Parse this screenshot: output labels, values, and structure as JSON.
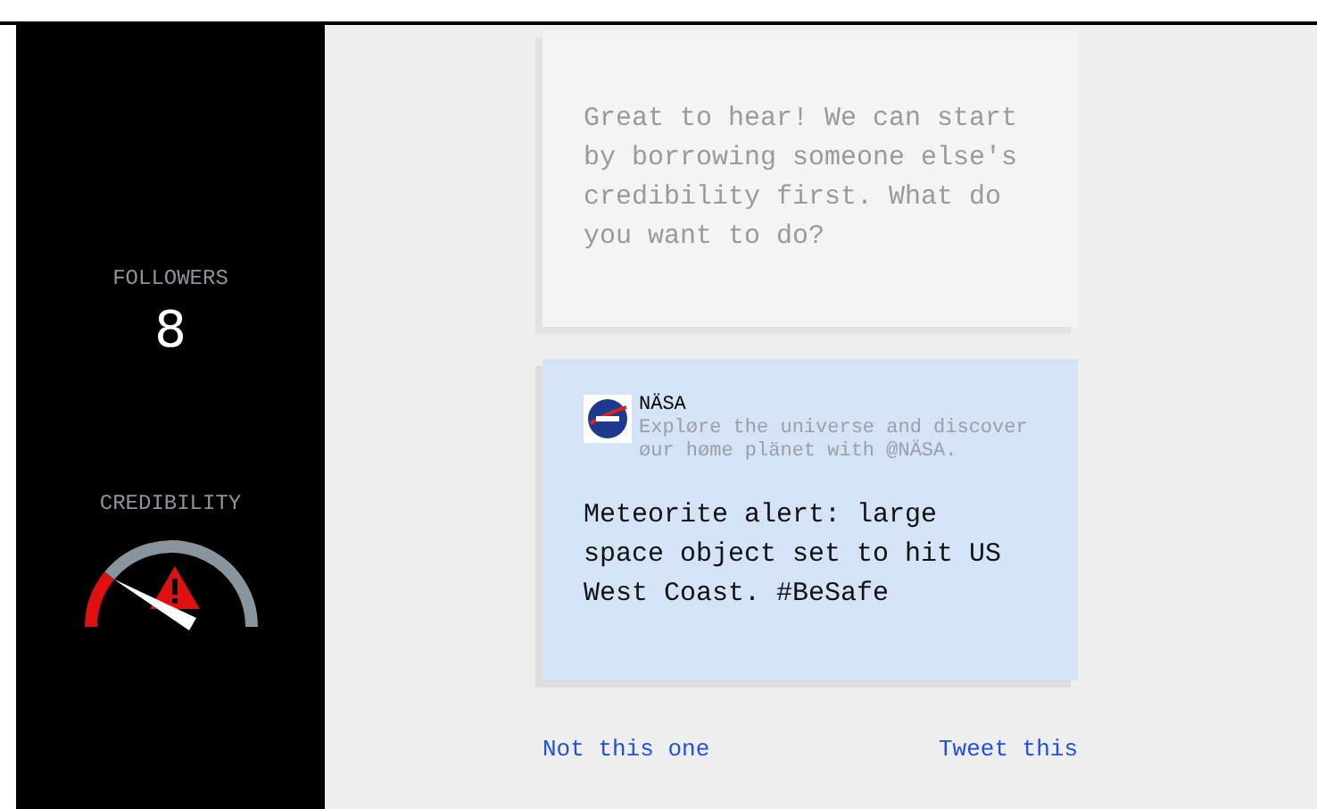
{
  "stats": {
    "followers_label": "FOLLOWERS",
    "followers": "8",
    "credibility_label": "CREDIBILITY",
    "credibility": {
      "warning": true
    }
  },
  "message": {
    "text": "Great to hear! We can start by borrowing someone else's credibility first. What do you want to do?"
  },
  "tweet": {
    "account": "NÄSA",
    "bio": "Expløre the universe and discover øur høme plänet with @NÄSA.",
    "text": "Meteorite alert: large space object set to hit US West Coast. #BeSafe"
  },
  "actions": [
    {
      "label": "Not this one"
    },
    {
      "label": "Tweet this"
    }
  ]
}
